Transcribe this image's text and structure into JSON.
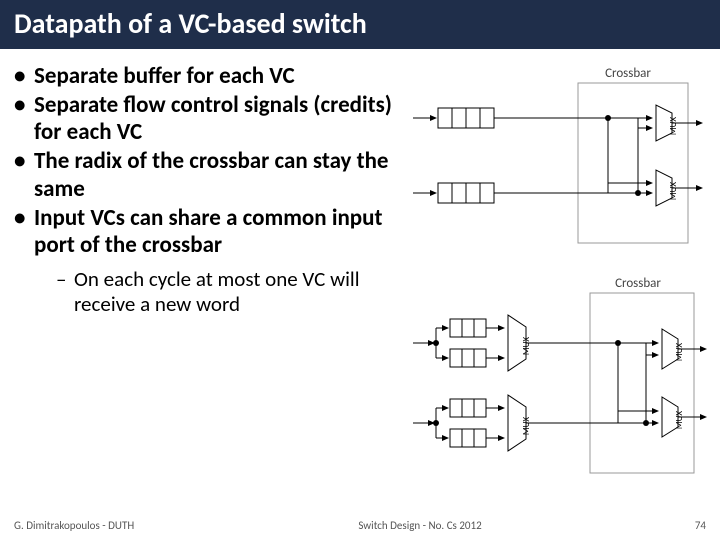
{
  "title": "Datapath of a VC-based switch",
  "bullets": [
    "Separate buffer for each VC",
    "Separate flow control signals (credits) for each VC",
    "The radix of the crossbar can stay the same",
    "Input VCs can share a common input port of the crossbar"
  ],
  "sub_bullet": "On each cycle at most one VC will receive a new word",
  "diagram": {
    "top_label": "Crossbar",
    "bottom_label": "Crossbar",
    "mux_label": "MUX"
  },
  "footer": {
    "left": "G. Dimitrakopoulos - DUTH",
    "center": "Switch Design - No. Cs 2012",
    "page": "74"
  }
}
